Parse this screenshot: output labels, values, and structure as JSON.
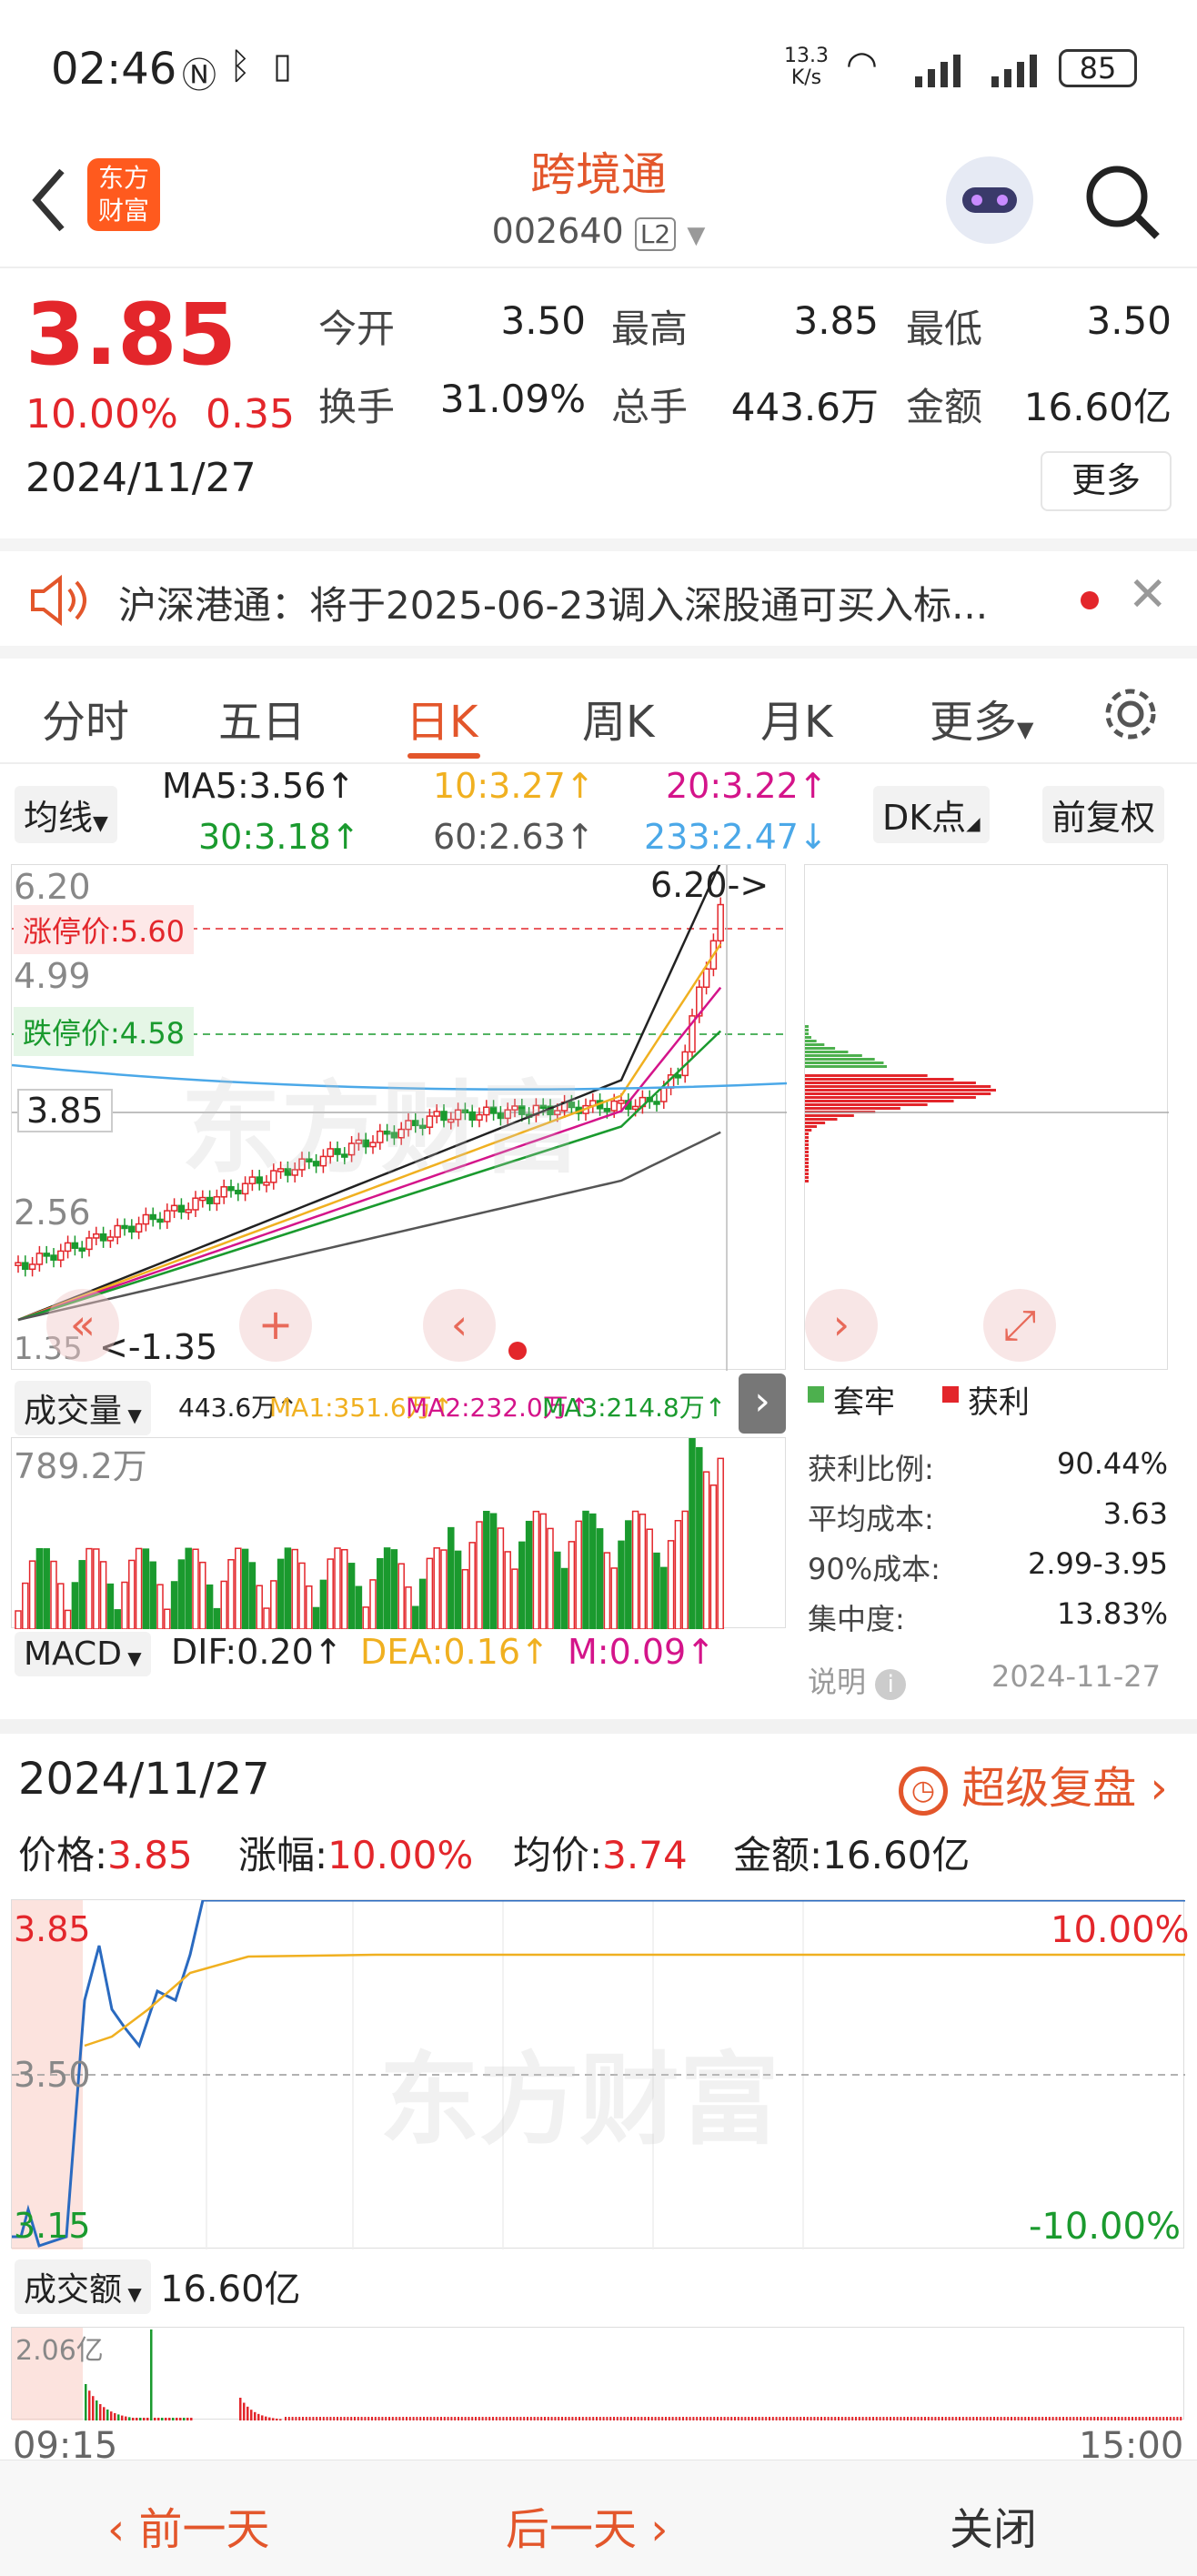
{
  "status_bar": {
    "time": "02:46",
    "net_speed_top": "13.3",
    "net_speed_unit": "K/s",
    "battery": "85"
  },
  "header": {
    "title": "跨境通",
    "code": "002640",
    "level_badge": "L2",
    "brand_line1": "东方",
    "brand_line2": "财富"
  },
  "quote": {
    "price": "3.85",
    "change_pct": "10.00%",
    "change": "0.35",
    "date": "2024/11/27",
    "open_label": "今开",
    "open": "3.50",
    "high_label": "最高",
    "high": "3.85",
    "low_label": "最低",
    "low": "3.50",
    "turnover_label": "换手",
    "turnover": "31.09%",
    "volume_label": "总手",
    "volume": "443.6万",
    "amount_label": "金额",
    "amount": "16.60亿",
    "more_button": "更多"
  },
  "notice": {
    "text": "沪深港通：将于2025-06-23调入深股通可买入标..."
  },
  "tabs": [
    {
      "label": "分时"
    },
    {
      "label": "五日"
    },
    {
      "label": "日K"
    },
    {
      "label": "周K"
    },
    {
      "label": "月K"
    },
    {
      "label": "更多"
    }
  ],
  "kline": {
    "indicator_select": "均线",
    "ma5": "MA5:3.56↑",
    "ma10": "10:3.27↑",
    "ma20": "20:3.22↑",
    "ma30": "30:3.18↑",
    "ma60": "60:2.63↑",
    "ma233": "233:2.47↓",
    "dk_button": "DK点",
    "adjust_button": "前复权",
    "y_top": "6.20",
    "limit_up": "涨停价:5.60",
    "y_mid1": "4.99",
    "limit_down": "跌停价:4.58",
    "current": "3.85",
    "y_mid2": "2.56",
    "y_low": "1.35",
    "high_marker": "6.20->",
    "low_marker": "<-1.35",
    "watermark": "东方财富"
  },
  "volume_panel": {
    "select": "成交量",
    "vol": "443.6万↑",
    "ma1": "MA1:351.6万↑",
    "ma2": "MA2:232.0万↑",
    "ma3": "MA3:214.8万↑",
    "y_max": "789.2万"
  },
  "macd_panel": {
    "select": "MACD",
    "dif": "DIF:0.20↑",
    "dea": "DEA:0.16↑",
    "m": "M:0.09↑"
  },
  "chip": {
    "legend_trapped": "套牢",
    "legend_profit": "获利",
    "rows": [
      {
        "label": "获利比例:",
        "value": "90.44%"
      },
      {
        "label": "平均成本:",
        "value": "3.63"
      },
      {
        "label": "90%成本:",
        "value": "2.99-3.95"
      },
      {
        "label": "集中度:",
        "value": "13.83%"
      }
    ],
    "explain": "说明",
    "date": "2024-11-27"
  },
  "intraday": {
    "date": "2024/11/27",
    "replay_label": "超级复盘",
    "price_label": "价格:",
    "price": "3.85",
    "change_label": "涨幅:",
    "change": "10.00%",
    "avg_label": "均价:",
    "avg": "3.74",
    "amount_label": "金额:",
    "amount": "16.60亿",
    "y_top": "3.85",
    "y_mid": "3.50",
    "y_low": "3.15",
    "pct_top": "10.00%",
    "pct_low": "-10.00%",
    "amt_select": "成交额",
    "amt_total": "16.60亿",
    "amt_max": "2.06亿",
    "t_start": "09:15",
    "t_end": "15:00",
    "watermark": "东方财富"
  },
  "footer": {
    "prev": "前一天",
    "next": "后一天",
    "close": "关闭"
  },
  "colors": {
    "red": "#e3262b",
    "green": "#1a9a2e",
    "accent": "#e3562b"
  }
}
